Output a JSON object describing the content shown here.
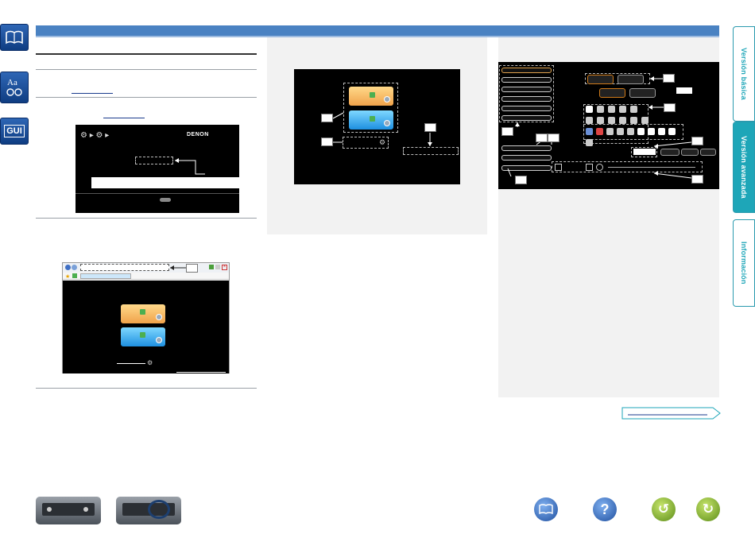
{
  "brand": {
    "logo_text": "DENON"
  },
  "side_tabs": [
    {
      "label": "Versión básica",
      "active": false
    },
    {
      "label": "Versión avanzada",
      "active": true
    },
    {
      "label": "Información",
      "active": false
    }
  ],
  "left_icons": [
    {
      "name": "book-icon",
      "glyph": "📖"
    },
    {
      "name": "glossary-icon",
      "glyph": "Aa"
    },
    {
      "name": "gui-icon",
      "glyph": "GUI"
    }
  ],
  "callouts": {
    "e": "e",
    "r": "r",
    "t": "t",
    "q": "q",
    "w": "w",
    "y": "y",
    "u": "u",
    "i": "i",
    "o": "o",
    "q0": "Q0",
    "q1": "Q1",
    "q2": "Q2",
    "q3": "q"
  },
  "colors": {
    "accent": "#4a82c2",
    "tab_active": "#1ea6b8",
    "tab_text": "#1ea6b8"
  }
}
